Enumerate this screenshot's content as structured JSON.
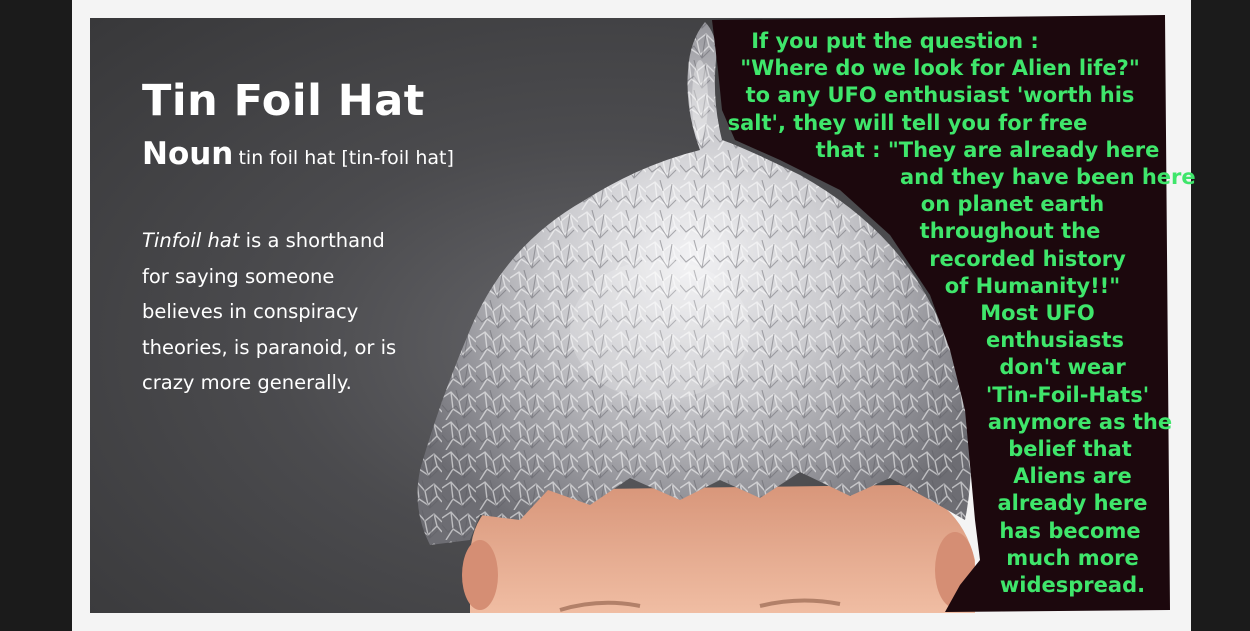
{
  "definition_card": {
    "title": "Tin Foil Hat",
    "part_of_speech": "Noun",
    "pronunciation": "tin foil hat [tin-foil hat]",
    "term": "Tinfoil hat",
    "body_lines": [
      " is a shorthand",
      "for saying someone",
      "believes in conspiracy",
      "theories, is paranoid, or is",
      "crazy more generally."
    ]
  },
  "callout": {
    "text_color": "#3fe66b",
    "background_color": "#1c080d",
    "lines": [
      "If you put the question :",
      "\"Where do we look for Alien life?\"",
      "to any UFO enthusiast 'worth his",
      "salt', they will tell you for free",
      "that : \"They are already here",
      "and they have been here",
      "on planet earth",
      "throughout the",
      "recorded history",
      "of Humanity!!\"",
      "Most UFO",
      "enthusiasts",
      "don't wear",
      "'Tin-Foil-Hats'",
      "anymore as the",
      "belief that",
      "Aliens are",
      "already here",
      "has become",
      "much more",
      "widespread."
    ]
  },
  "colors": {
    "panel_background": "#4a4a4d",
    "frame_background": "#f4f4f4",
    "foil": "#c9c9cc",
    "skin": "#e6ad92"
  }
}
